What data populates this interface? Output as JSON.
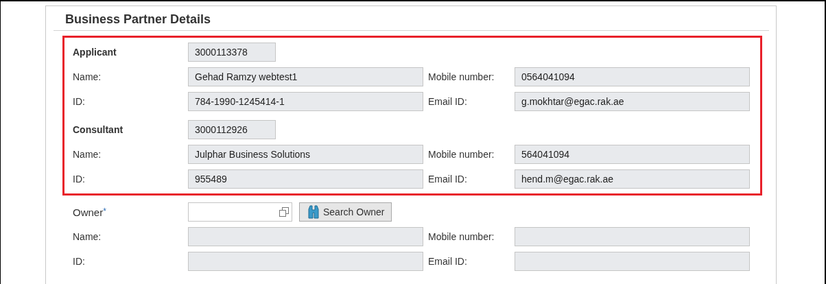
{
  "panel": {
    "title": "Business Partner Details"
  },
  "parties": [
    {
      "kind": "display",
      "highlighted": true,
      "role": "Applicant",
      "number": "3000113378",
      "rows": [
        {
          "label": "Name:",
          "value": "Gehad Ramzy webtest1",
          "side_label": "Mobile number:",
          "side_value": "0564041094"
        },
        {
          "label": "ID:",
          "value": "784-1990-1245414-1",
          "side_label": "Email ID:",
          "side_value": "g.mokhtar@egac.rak.ae"
        }
      ]
    },
    {
      "kind": "display",
      "highlighted": true,
      "role": "Consultant",
      "number": "3000112926",
      "rows": [
        {
          "label": "Name:",
          "value": "Julphar Business Solutions",
          "side_label": "Mobile number:",
          "side_value": "564041094"
        },
        {
          "label": "ID:",
          "value": "955489",
          "side_label": "Email ID:",
          "side_value": "hend.m@egac.rak.ae"
        }
      ]
    },
    {
      "kind": "lookup",
      "highlighted": false,
      "role": "Owner",
      "required_mark": "*",
      "button": "Search Owner",
      "rows": [
        {
          "label": "Name:",
          "side_label": "Mobile number:"
        },
        {
          "label": "ID:",
          "side_label": "Email ID:"
        }
      ]
    }
  ]
}
